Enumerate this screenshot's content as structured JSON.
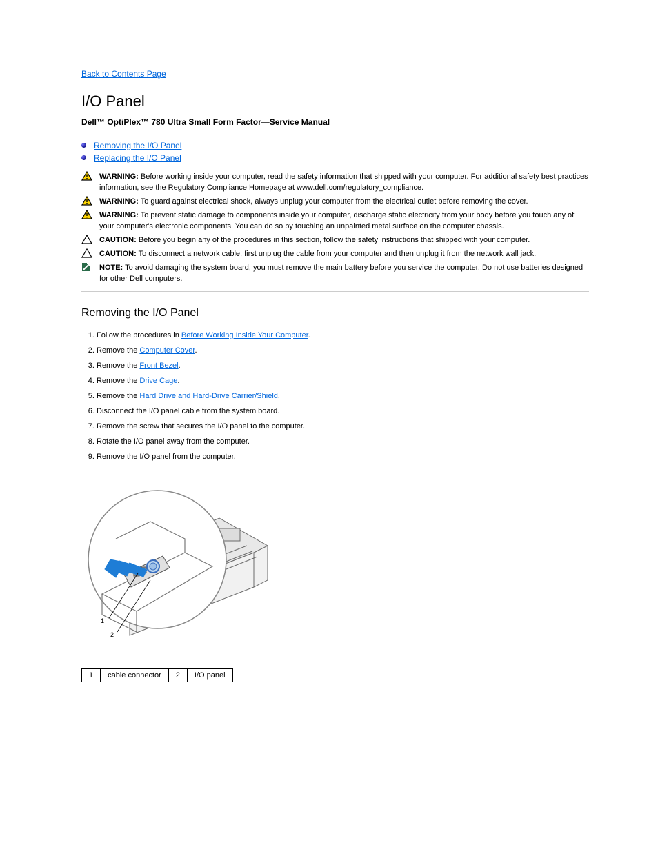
{
  "nav": {
    "back": "Back to Contents Page"
  },
  "header": {
    "title": "I/O Panel",
    "subtitle": "Dell™ OptiPlex™ 780 Ultra Small Form Factor—Service Manual"
  },
  "toc": {
    "items": [
      {
        "label": "Removing the I/O Panel"
      },
      {
        "label": "Replacing the I/O Panel"
      }
    ]
  },
  "warn": {
    "w1_label": "WARNING:",
    "w1_text": "Before working inside your computer, read the safety information that shipped with your computer. For additional safety best practices information, see the Regulatory Compliance Homepage at www.dell.com/regulatory_compliance.",
    "w2_label": "WARNING:",
    "w2_text": "To guard against electrical shock, always unplug your computer from the electrical outlet before removing the cover.",
    "w3_label": "WARNING:",
    "w3_text": "To prevent static damage to components inside your computer, discharge static electricity from your body before you touch any of your computer's electronic components. You can do so by touching an unpainted metal surface on the computer chassis.",
    "c1_label": "CAUTION:",
    "c1_text": "Before you begin any of the procedures in this section, follow the safety instructions that shipped with your computer.",
    "c2_label": "CAUTION:",
    "c2_text": "To disconnect a network cable, first unplug the cable from your computer and then unplug it from the network wall jack.",
    "n1_label": "NOTE:",
    "n1_text": "To avoid damaging the system board, you must remove the main battery before you service the computer. Do not use batteries designed for other Dell computers."
  },
  "section": {
    "removing": "Removing the I/O Panel"
  },
  "steps": {
    "s1a": "Follow the procedures in ",
    "s1_link": "Before Working Inside Your Computer",
    "s1b": ".",
    "s2a": "Remove the ",
    "s2_link": "Computer Cover",
    "s2b": ".",
    "s3a": "Remove the ",
    "s3_link": "Front Bezel",
    "s3b": ".",
    "s4a": "Remove the ",
    "s4_link": "Drive Cage",
    "s4b": ".",
    "s5a": "Remove the ",
    "s5_link": "Hard Drive and Hard-Drive Carrier/Shield",
    "s5b": ".",
    "s6": "Disconnect the I/O panel cable from the system board.",
    "s7": "Remove the screw that secures the I/O panel to the computer.",
    "s8": "Rotate the I/O panel away from the computer.",
    "s9": "Remove the I/O panel from the computer."
  },
  "figure": {
    "callouts": {
      "c1": "1",
      "c2": "2"
    },
    "legend": {
      "r1n": "1",
      "r1t": "cable connector",
      "r2n": "2",
      "r2t": "I/O panel"
    }
  }
}
